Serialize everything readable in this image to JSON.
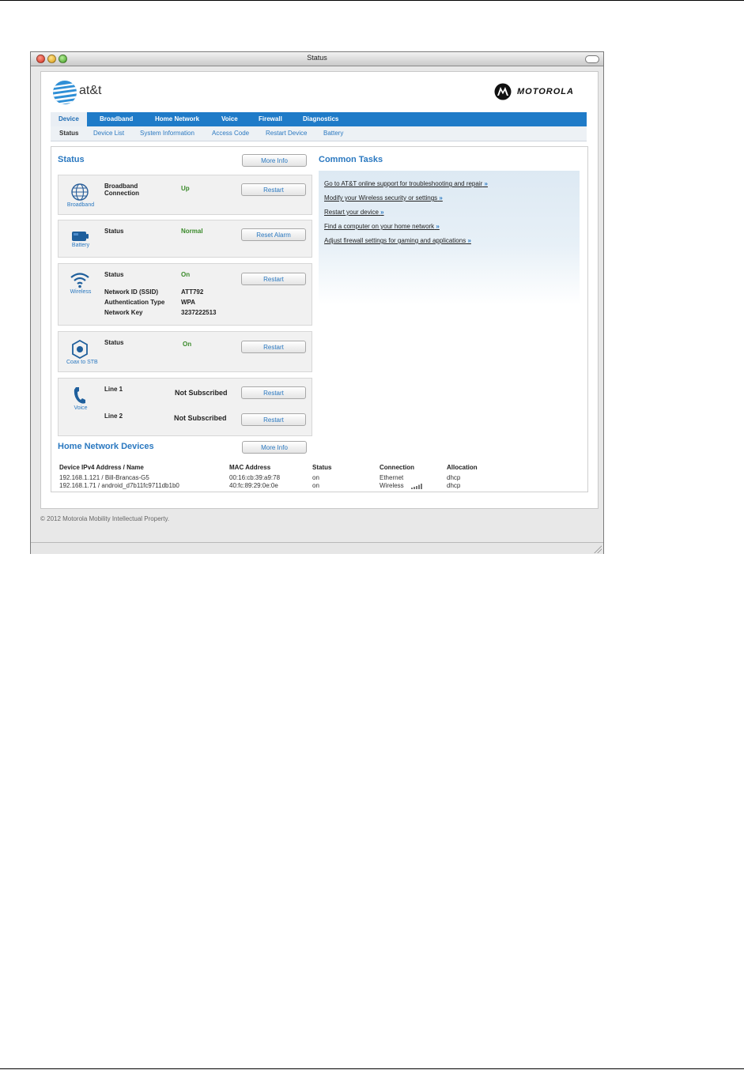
{
  "window": {
    "title": "Status"
  },
  "brand": {
    "att": "at&t",
    "motorola": "MOTOROLA"
  },
  "nav": {
    "tabs": [
      "Device",
      "Broadband",
      "Home Network",
      "Voice",
      "Firewall",
      "Diagnostics"
    ],
    "active": "Device",
    "subtabs": [
      "Status",
      "Device List",
      "System Information",
      "Access Code",
      "Restart Device",
      "Battery"
    ]
  },
  "status_section": {
    "title": "Status",
    "more_info": "More Info",
    "broadband": {
      "icon_label": "Broadband",
      "label": "Broadband Connection",
      "value": "Up",
      "button": "Restart"
    },
    "battery": {
      "icon_label": "Battery",
      "label": "Status",
      "value": "Normal",
      "button": "Reset Alarm"
    },
    "wireless": {
      "icon_label": "Wireless",
      "status_label": "Status",
      "status_value": "On",
      "button": "Restart",
      "ssid_label": "Network ID (SSID)",
      "ssid_value": "ATT792",
      "auth_label": "Authentication Type",
      "auth_value": "WPA",
      "key_label": "Network Key",
      "key_value": "3237222513"
    },
    "coax": {
      "icon_label": "Coax to STB",
      "label": "Status",
      "value": "On",
      "button": "Restart"
    },
    "voice": {
      "icon_label": "Voice",
      "line1_label": "Line 1",
      "line1_value": "Not Subscribed",
      "line1_button": "Restart",
      "line2_label": "Line 2",
      "line2_value": "Not Subscribed",
      "line2_button": "Restart"
    }
  },
  "common_tasks": {
    "title": "Common Tasks",
    "arrow": "»",
    "links": [
      "Go to AT&T online support for troubleshooting and repair",
      "Modify your Wireless security or settings",
      "Restart your device",
      "Find a computer on your home network",
      "Adjust firewall settings for gaming and applications"
    ]
  },
  "home_network": {
    "title": "Home Network Devices",
    "more_info": "More Info",
    "columns": [
      "Device IPv4 Address / Name",
      "MAC Address",
      "Status",
      "Connection",
      "Allocation"
    ],
    "rows": [
      [
        "192.168.1.121 / Bill-Brancas-G5",
        "00:16:cb:39:a9:78",
        "on",
        "Ethernet",
        "dhcp"
      ],
      [
        "192.168.1.71 /  android_d7b11fc9711db1b0",
        "40:fc:89:29:0e:0e",
        "on",
        "Wireless",
        "dhcp"
      ]
    ]
  },
  "footer": "© 2012 Motorola Mobility Intellectual Property.",
  "colors": {
    "nav_blue": "#1f7bc8",
    "link_blue": "#2a78c0",
    "status_green": "#3a8a2a"
  }
}
